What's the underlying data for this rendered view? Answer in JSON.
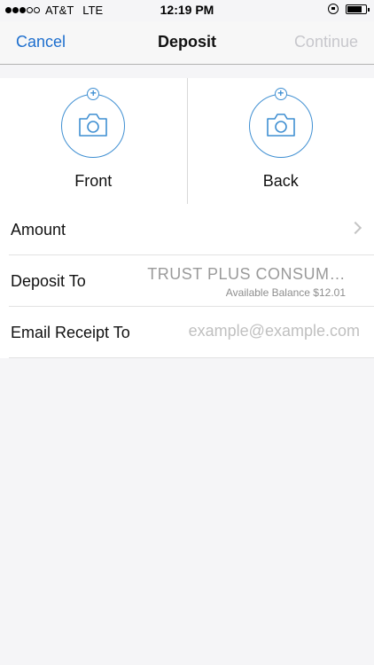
{
  "status_bar": {
    "carrier": "AT&T",
    "network": "LTE",
    "time": "12:19 PM",
    "signal_bars": 3,
    "signal_total": 5
  },
  "nav": {
    "cancel": "Cancel",
    "title": "Deposit",
    "continue": "Continue"
  },
  "capture": {
    "front_label": "Front",
    "back_label": "Back"
  },
  "form": {
    "amount_label": "Amount",
    "deposit_to_label": "Deposit To",
    "deposit_account": "TRUST PLUS CONSUM…",
    "available_balance": "Available Balance $12.01",
    "email_label": "Email Receipt To",
    "email_placeholder": "example@example.com"
  },
  "colors": {
    "accent": "#1e6fce",
    "camera": "#3f8fd2",
    "disabled": "#c7c7cc"
  }
}
